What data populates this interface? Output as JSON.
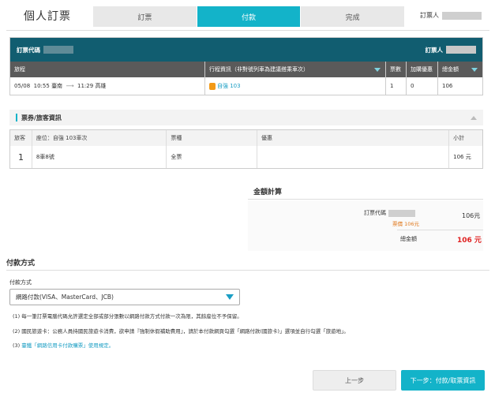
{
  "header": {
    "title": "個人訂票",
    "steps": [
      "訂票",
      "付款",
      "完成"
    ],
    "active_step": 1,
    "booker_label": "訂票人"
  },
  "trip": {
    "code_label": "訂票代碼",
    "booker_label": "訂票人",
    "columns": [
      "旅程",
      "行程資訊（非對號列車為建議搭乘車次）",
      "票數",
      "加購優惠",
      "總金額"
    ],
    "row": {
      "date": "05/08",
      "depart_time": "10:55",
      "depart_station": "臺南",
      "arrow": "⟶",
      "arrive_time": "11:29",
      "arrive_station": "高雄",
      "train": "自強 103",
      "tickets": "1",
      "addon": "0",
      "total": "106"
    }
  },
  "passengers": {
    "section_label": "票券/旅客資訊",
    "columns": [
      "旅客",
      "座位：自強 103車次",
      "票種",
      "優惠",
      "小計"
    ],
    "rows": [
      {
        "no": "1",
        "seat": "8車8號",
        "type": "全票",
        "discount": "",
        "subtotal": "106 元"
      }
    ]
  },
  "summary": {
    "title": "金額計算",
    "code_label": "訂票代碼",
    "amount": "106元",
    "sub_note": "票價 106元",
    "grand_label": "總金額",
    "grand_value": "106 元"
  },
  "payment": {
    "section_title": "付款方式",
    "field_label": "付款方式",
    "selected": "網路付款(VISA、MasterCard、JCB)",
    "notes": [
      "(1) 每一筆訂票電腦代碼允許選定全部或部分張數以網路付款方式付款一次為限，其餘座位不予保留。",
      "(2) 國民旅遊卡：公務人員持國民旅遊卡消費，欲申請『強制休假補助費用』，請於本付款網頁勾選「網路付款(國旅卡)」選項並自行勾選「旅遊地」。"
    ],
    "link_prefix": "(3)",
    "link_text": "臺鐵「網路信用卡付款購票」使用規定。"
  },
  "buttons": {
    "prev": "上一步",
    "next": "下一步：付款/取票資訊"
  },
  "colors": {
    "accent": "#13b3c9",
    "header_dark": "#115d70",
    "column_dark": "#5a5a5a",
    "price_red": "#e02020",
    "link_blue": "#1a9ec4"
  }
}
